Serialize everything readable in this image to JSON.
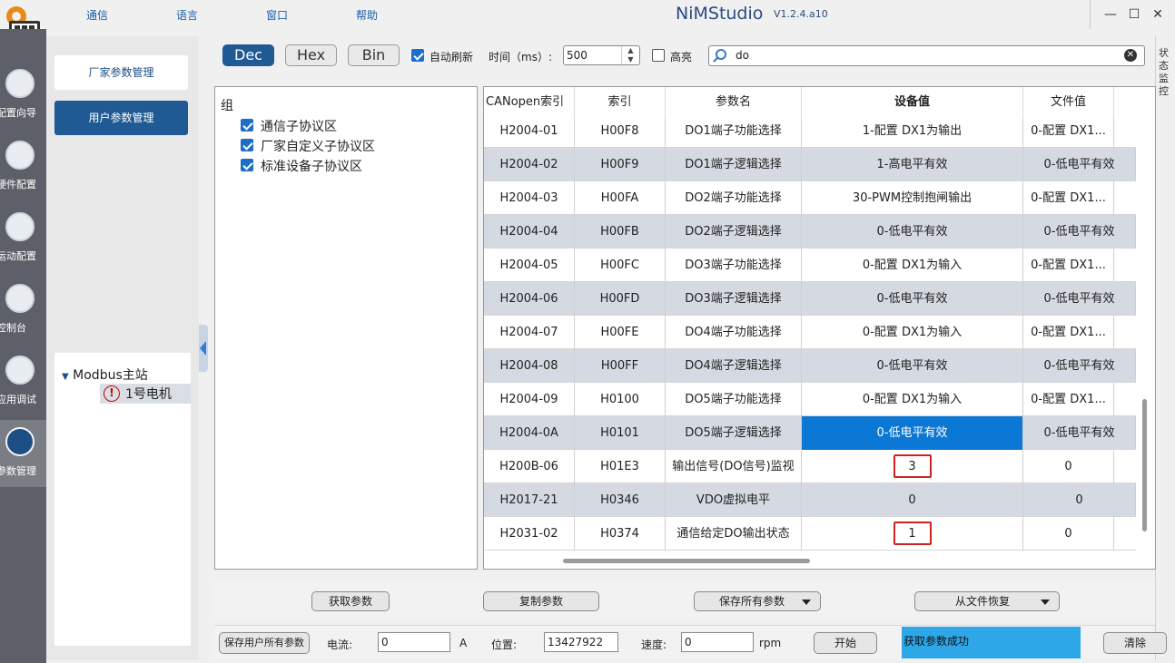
{
  "titlebar": {
    "app_name": "NiMStudio",
    "version": "V1.2.4.a10",
    "menus": [
      "通信",
      "语言",
      "窗口",
      "帮助"
    ]
  },
  "window_controls": {
    "minimize": "—",
    "maximize": "☐",
    "close": "✕"
  },
  "leftnav": {
    "items": [
      {
        "label": "配置向导",
        "icon": "wizard-icon"
      },
      {
        "label": "硬件配置",
        "icon": "hardware-icon"
      },
      {
        "label": "运动配置",
        "icon": "motion-icon"
      },
      {
        "label": "控制台",
        "icon": "gauge-icon"
      },
      {
        "label": "应用调试",
        "icon": "sliders-icon"
      },
      {
        "label": "参数管理",
        "icon": "grid-icon",
        "active": true
      }
    ]
  },
  "sidebar": {
    "buttons": [
      "厂家参数管理",
      "用户参数管理"
    ],
    "tree": {
      "root": "Modbus主站",
      "child": "1号电机",
      "expand_glyph": "▼",
      "warn_glyph": "!"
    }
  },
  "toolbar": {
    "formats": [
      "Dec",
      "Hex",
      "Bin"
    ],
    "auto_refresh": "自动刷新",
    "interval_label": "时间（ms）:",
    "interval_value": "500",
    "spin_up": "▲",
    "spin_down": "▼",
    "highlight_label": "高亮",
    "search_value": "do",
    "clear_glyph": "✕"
  },
  "right_strip": {
    "label": "状态监控"
  },
  "groups": {
    "title": "组",
    "items": [
      "通信子协议区",
      "厂家自定义子协议区",
      "标准设备子协议区"
    ]
  },
  "table": {
    "headers": [
      "CANopen索引",
      "索引",
      "参数名",
      "设备值",
      "文件值"
    ],
    "rows": [
      [
        "H2004-01",
        "H00F8",
        "DO1端子功能选择",
        "1-配置 DX1为输出",
        "0-配置 DX1..."
      ],
      [
        "H2004-02",
        "H00F9",
        "DO1端子逻辑选择",
        "1-高电平有效",
        "0-低电平有效"
      ],
      [
        "H2004-03",
        "H00FA",
        "DO2端子功能选择",
        "30-PWM控制抱闸输出",
        "0-配置 DX1..."
      ],
      [
        "H2004-04",
        "H00FB",
        "DO2端子逻辑选择",
        "0-低电平有效",
        "0-低电平有效"
      ],
      [
        "H2004-05",
        "H00FC",
        "DO3端子功能选择",
        "0-配置 DX1为输入",
        "0-配置 DX1..."
      ],
      [
        "H2004-06",
        "H00FD",
        "DO3端子逻辑选择",
        "0-低电平有效",
        "0-低电平有效"
      ],
      [
        "H2004-07",
        "H00FE",
        "DO4端子功能选择",
        "0-配置 DX1为输入",
        "0-配置 DX1..."
      ],
      [
        "H2004-08",
        "H00FF",
        "DO4端子逻辑选择",
        "0-低电平有效",
        "0-低电平有效"
      ],
      [
        "H2004-09",
        "H0100",
        "DO5端子功能选择",
        "0-配置 DX1为输入",
        "0-配置 DX1..."
      ],
      [
        "H2004-0A",
        "H0101",
        "DO5端子逻辑选择",
        "0-低电平有效",
        "0-低电平有效"
      ],
      [
        "H200B-06",
        "H01E3",
        "输出信号(DO信号)监视",
        "3",
        "0"
      ],
      [
        "H2017-21",
        "H0346",
        "VDO虚拟电平",
        "0",
        "0"
      ],
      [
        "H2031-02",
        "H0374",
        "通信给定DO输出状态",
        "1",
        "0"
      ]
    ]
  },
  "actions": {
    "get_params": "获取参数",
    "copy_params": "复制参数",
    "save_all": "保存所有参数",
    "restore_from_file": "从文件恢复"
  },
  "status": {
    "save_user_all": "保存用户所有参数",
    "current_label": "电流:",
    "current_value": "0",
    "current_unit": "A",
    "position_label": "位置:",
    "position_value": "13427922",
    "speed_label": "速度:",
    "speed_value": "0",
    "speed_unit": "rpm",
    "start": "开始",
    "message": "获取参数成功",
    "clear": "清除"
  }
}
